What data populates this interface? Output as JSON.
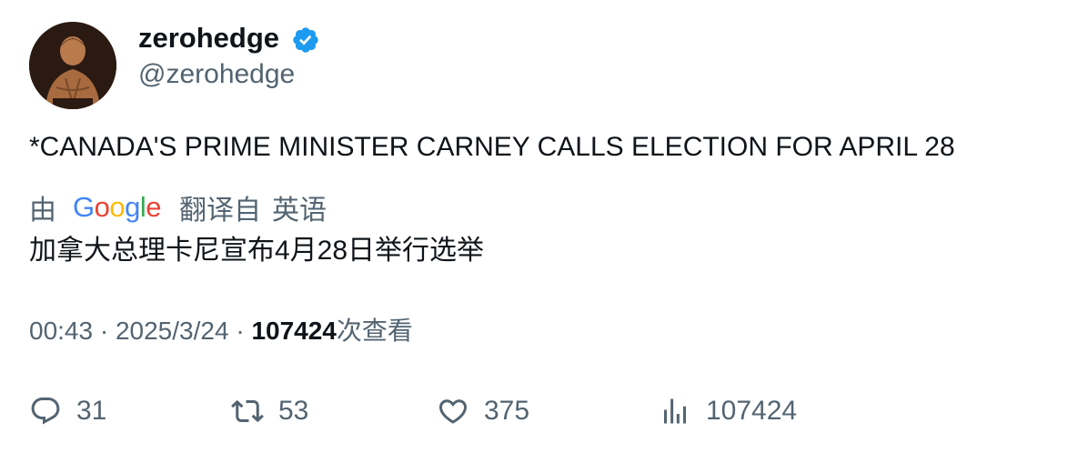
{
  "author": {
    "display_name": "zerohedge",
    "handle": "@zerohedge",
    "verified": true,
    "verified_color": "#1d9bf0"
  },
  "tweet": {
    "text": "*CANADA'S PRIME MINISTER CARNEY CALLS ELECTION FOR APRIL 28"
  },
  "translation": {
    "by_label": "由",
    "provider": "Google",
    "from_label": "翻译自",
    "language": "英语",
    "text": "加拿大总理卡尼宣布4月28日举行选举"
  },
  "meta": {
    "time": "00:43",
    "separator": "·",
    "date": "2025/3/24",
    "views_count": "107424",
    "views_label": "次查看"
  },
  "actions": {
    "replies": "31",
    "retweets": "53",
    "likes": "375",
    "views": "107424"
  },
  "colors": {
    "text_primary": "#0f1419",
    "text_secondary": "#536471",
    "google_blue": "#4285f4",
    "google_red": "#ea4335",
    "google_yellow": "#fbbc05",
    "google_green": "#34a853"
  }
}
